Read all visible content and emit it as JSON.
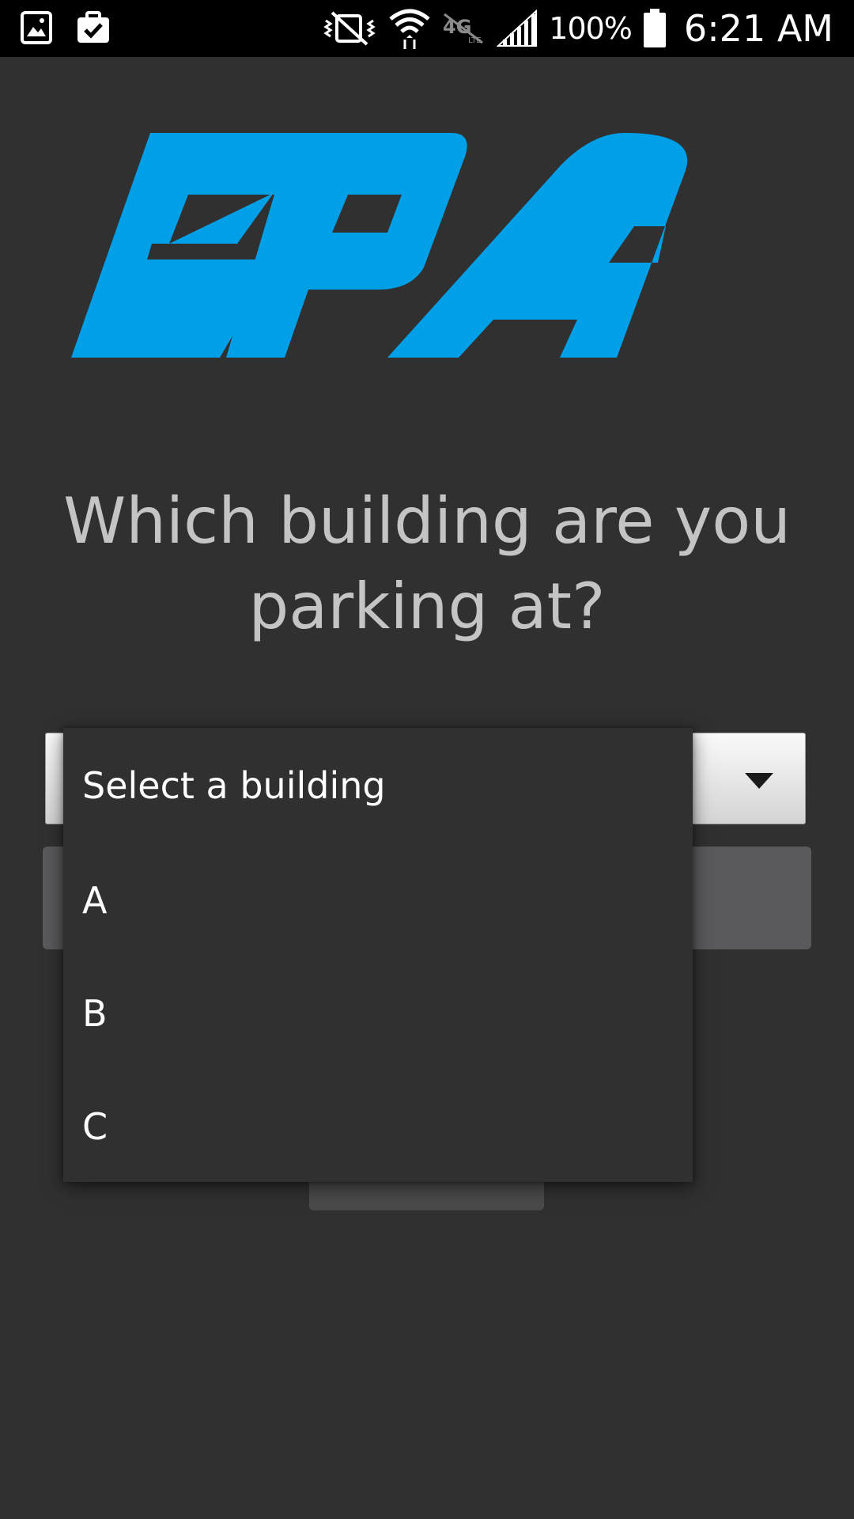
{
  "status_bar": {
    "battery_percent": "100%",
    "time": "6:21 AM",
    "left_icons": [
      "gallery-icon",
      "clipboard-check-icon"
    ],
    "right_icons": [
      "mute-vibrate-icon",
      "wifi-icon",
      "4g-lte-off-icon",
      "signal-icon",
      "battery-icon"
    ]
  },
  "logo": {
    "text": "EPA",
    "color": "#00a0e9"
  },
  "question": {
    "line1": "Which building are you",
    "line2": "parking at?"
  },
  "building_select": {
    "selected": "Select a building",
    "options": [
      "Select a building",
      "A",
      "B",
      "C"
    ]
  },
  "colors": {
    "background": "#303030",
    "status_bar": "#000000",
    "question_text": "#c4c4c4",
    "dropdown_text": "#ffffff",
    "button": "#5a5a5c"
  }
}
